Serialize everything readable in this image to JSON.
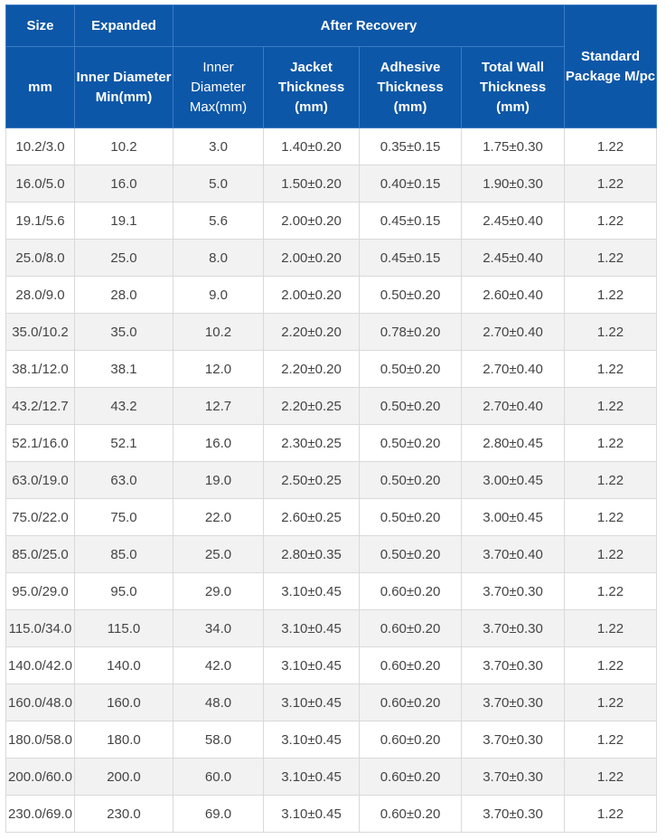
{
  "header": {
    "size": "Size",
    "expanded": "Expanded",
    "after_recovery": "After Recovery",
    "standard_package": "Standard Package M/pc",
    "size_unit": "mm",
    "inner_diameter_min": "Inner Diameter Min(mm)",
    "inner_diameter_max": "Inner Diameter Max(mm)",
    "jacket_thickness": "Jacket Thickness (mm)",
    "adhesive_thickness": "Adhesive Thickness (mm)",
    "total_wall_thickness": "Total Wall Thickness (mm)"
  },
  "rows": [
    [
      "10.2/3.0",
      "10.2",
      "3.0",
      "1.40±0.20",
      "0.35±0.15",
      "1.75±0.30",
      "1.22"
    ],
    [
      "16.0/5.0",
      "16.0",
      "5.0",
      "1.50±0.20",
      "0.40±0.15",
      "1.90±0.30",
      "1.22"
    ],
    [
      "19.1/5.6",
      "19.1",
      "5.6",
      "2.00±0.20",
      "0.45±0.15",
      "2.45±0.40",
      "1.22"
    ],
    [
      "25.0/8.0",
      "25.0",
      "8.0",
      "2.00±0.20",
      "0.45±0.15",
      "2.45±0.40",
      "1.22"
    ],
    [
      "28.0/9.0",
      "28.0",
      "9.0",
      "2.00±0.20",
      "0.50±0.20",
      "2.60±0.40",
      "1.22"
    ],
    [
      "35.0/10.2",
      "35.0",
      "10.2",
      "2.20±0.20",
      "0.78±0.20",
      "2.70±0.40",
      "1.22"
    ],
    [
      "38.1/12.0",
      "38.1",
      "12.0",
      "2.20±0.20",
      "0.50±0.20",
      "2.70±0.40",
      "1.22"
    ],
    [
      "43.2/12.7",
      "43.2",
      "12.7",
      "2.20±0.25",
      "0.50±0.20",
      "2.70±0.40",
      "1.22"
    ],
    [
      "52.1/16.0",
      "52.1",
      "16.0",
      "2.30±0.25",
      "0.50±0.20",
      "2.80±0.45",
      "1.22"
    ],
    [
      "63.0/19.0",
      "63.0",
      "19.0",
      "2.50±0.25",
      "0.50±0.20",
      "3.00±0.45",
      "1.22"
    ],
    [
      "75.0/22.0",
      "75.0",
      "22.0",
      "2.60±0.25",
      "0.50±0.20",
      "3.00±0.45",
      "1.22"
    ],
    [
      "85.0/25.0",
      "85.0",
      "25.0",
      "2.80±0.35",
      "0.50±0.20",
      "3.70±0.40",
      "1.22"
    ],
    [
      "95.0/29.0",
      "95.0",
      "29.0",
      "3.10±0.45",
      "0.60±0.20",
      "3.70±0.30",
      "1.22"
    ],
    [
      "115.0/34.0",
      "115.0",
      "34.0",
      "3.10±0.45",
      "0.60±0.20",
      "3.70±0.30",
      "1.22"
    ],
    [
      "140.0/42.0",
      "140.0",
      "42.0",
      "3.10±0.45",
      "0.60±0.20",
      "3.70±0.30",
      "1.22"
    ],
    [
      "160.0/48.0",
      "160.0",
      "48.0",
      "3.10±0.45",
      "0.60±0.20",
      "3.70±0.30",
      "1.22"
    ],
    [
      "180.0/58.0",
      "180.0",
      "58.0",
      "3.10±0.45",
      "0.60±0.20",
      "3.70±0.30",
      "1.22"
    ],
    [
      "200.0/60.0",
      "200.0",
      "60.0",
      "3.10±0.45",
      "0.60±0.20",
      "3.70±0.30",
      "1.22"
    ],
    [
      "230.0/69.0",
      "230.0",
      "69.0",
      "3.10±0.45",
      "0.60±0.20",
      "3.70±0.30",
      "1.22"
    ]
  ],
  "colors": {
    "header_bg": "#0d57a8",
    "header_text": "#ffffff",
    "row_alt_bg": "#f2f2f2",
    "body_text": "#444444"
  }
}
